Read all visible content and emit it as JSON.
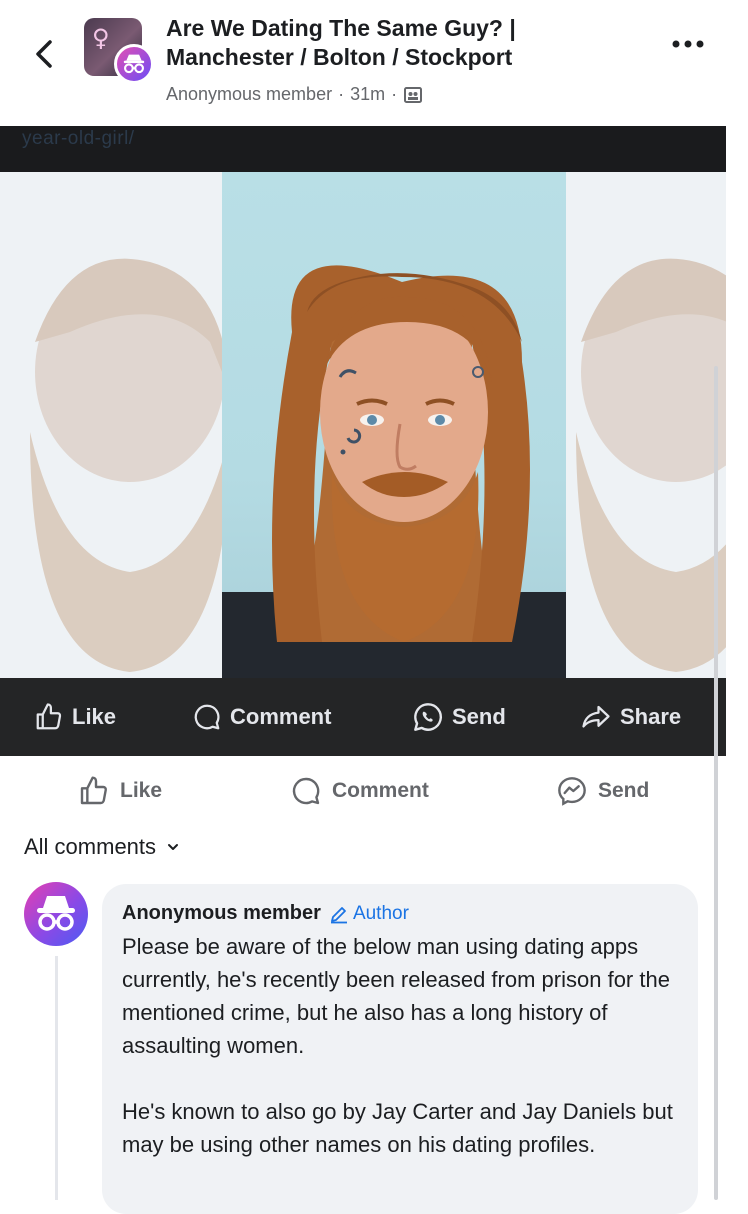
{
  "header": {
    "group_name": "Are We Dating The Same Guy? | Manchester / Bolton / Stockport",
    "author": "Anonymous member",
    "separator": "·",
    "time": "31m",
    "separator2": "·"
  },
  "banner": {
    "link_text": "year-old-girl/"
  },
  "shared_actions": {
    "like": "Like",
    "comment": "Comment",
    "send": "Send",
    "share": "Share"
  },
  "post_actions": {
    "like": "Like",
    "comment": "Comment",
    "send": "Send"
  },
  "comments_filter": {
    "label": "All comments"
  },
  "comment": {
    "author": "Anonymous member",
    "badge": "Author",
    "paragraph1": "Please be aware of the below man using dating apps currently, he's recently been released from prison for the mentioned crime, but he also has a long history of assaulting women.",
    "paragraph2": "He's known to also go by Jay Carter and Jay Daniels but may be using other names on his dating profiles."
  },
  "colors": {
    "accent": "#1b74e4",
    "dark_bar": "#242526",
    "anon_gradient_start": "#e63fb0",
    "anon_gradient_end": "#4a5cf3"
  },
  "icons": [
    "chevron-left-icon",
    "anonymous-icon",
    "more-icon",
    "members-icon",
    "like-icon",
    "comment-icon",
    "whatsapp-send-icon",
    "share-icon",
    "messenger-send-icon",
    "chevron-down-icon",
    "pencil-icon"
  ]
}
